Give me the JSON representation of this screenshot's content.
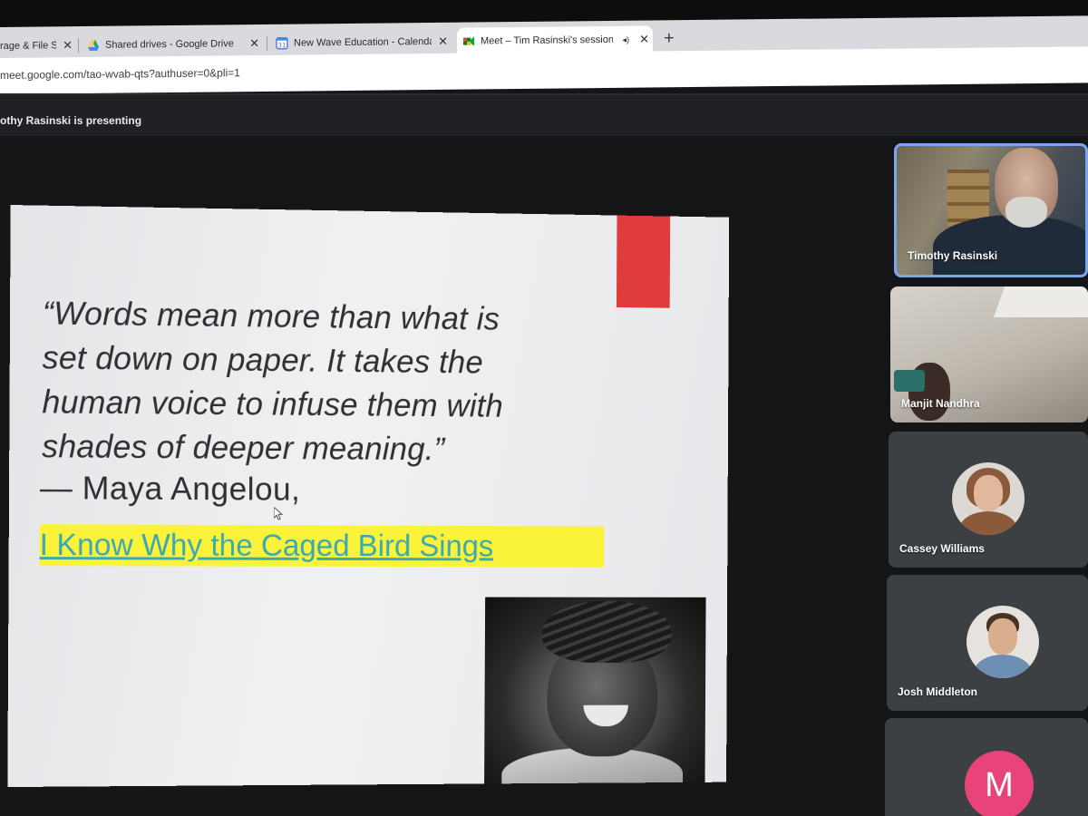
{
  "browser": {
    "tabs": [
      {
        "label": "rage & File Sh",
        "icon": "none",
        "active": false
      },
      {
        "label": "Shared drives - Google Drive",
        "icon": "google-drive-icon",
        "active": false
      },
      {
        "label": "New Wave Education - Calendar",
        "icon": "google-calendar-icon",
        "active": false
      },
      {
        "label": "Meet – Tim Rasinski's session",
        "icon": "google-meet-icon",
        "active": true
      }
    ],
    "close_glyph": "✕",
    "new_tab_glyph": "+",
    "audio_glyph": "◂)",
    "url": "meet.google.com/tao-wvab-qts?authuser=0&pli=1"
  },
  "meet": {
    "presenting_label": "othy Rasinski is presenting"
  },
  "slide": {
    "quote_lines": [
      "“Words mean more than what is",
      "set down on paper. It takes the",
      "human voice to infuse them with",
      "shades of deeper meaning.”"
    ],
    "author": "— Maya Angelou,",
    "book_title": "I Know Why the Caged Bird Sings",
    "colors": {
      "accent_red": "#e03c3c",
      "highlight_yellow": "#fbf33a",
      "link_teal": "#3aa9b4"
    }
  },
  "participants": [
    {
      "name": "Timothy Rasinski",
      "type": "video",
      "active": true
    },
    {
      "name": "Manjit Nandhra",
      "type": "video",
      "active": false
    },
    {
      "name": "Cassey Williams",
      "type": "photo-avatar",
      "active": false
    },
    {
      "name": "Josh Middleton",
      "type": "photo-avatar",
      "active": false
    },
    {
      "name": "",
      "type": "letter-avatar",
      "letter": "M",
      "active": false
    }
  ]
}
